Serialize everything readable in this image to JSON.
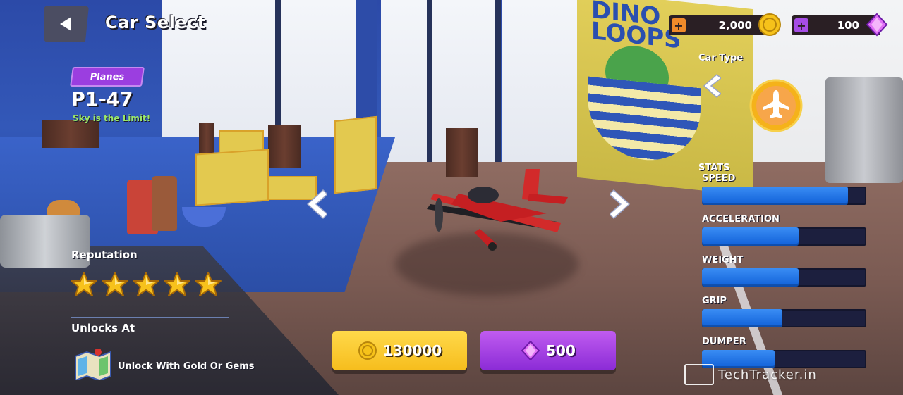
{
  "header": {
    "title": "Car Select"
  },
  "car": {
    "class": "Planes",
    "name": "P1-47",
    "tagline": "Sky is the Limit!",
    "reputation_label": "Reputation",
    "reputation_stars": 5,
    "unlocks_label": "Unlocks At",
    "unlock_method": "Unlock With Gold Or Gems"
  },
  "currency": {
    "gold": "2,000",
    "gems": "100"
  },
  "car_type": {
    "label": "Car Type",
    "selected_icon": "plane-icon"
  },
  "stats": {
    "title": "STATS",
    "items": [
      {
        "label": "SPEED",
        "value": 0.89
      },
      {
        "label": "ACCELERATION",
        "value": 0.59
      },
      {
        "label": "WEIGHT",
        "value": 0.59
      },
      {
        "label": "GRIP",
        "value": 0.49
      },
      {
        "label": "DUMPER",
        "value": 0.44
      }
    ]
  },
  "purchase": {
    "gold_price": "130000",
    "gem_price": "500"
  },
  "watermark": "TechTracker.in",
  "colors": {
    "gold_button": "#f6bd1d",
    "gem_button": "#8b2bd6",
    "stat_fill": "#1060d8",
    "class_badge": "#9b3ee0"
  }
}
